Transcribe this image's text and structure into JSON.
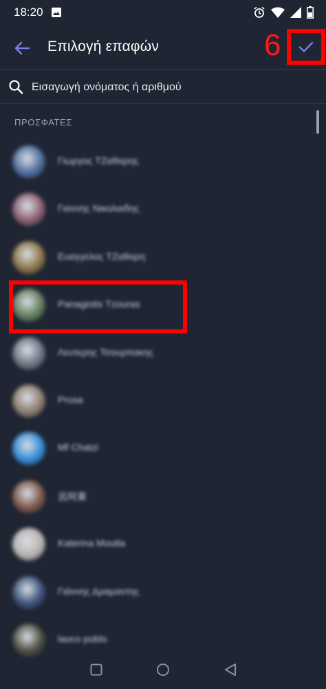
{
  "status_bar": {
    "time": "18:20"
  },
  "app_bar": {
    "title": "Επιλογή επαφών",
    "step_badge": "6"
  },
  "search": {
    "placeholder": "Εισαγωγή ονόματος ή αριθμού"
  },
  "section": {
    "header": "ΠΡΟΣΦΑΤΕΣ"
  },
  "contacts": [
    {
      "name": "Γιωργος ΤΖαθαρης",
      "avatar_color": "#4a6a9a"
    },
    {
      "name": "Γιαννης Νικολαιδης",
      "avatar_color": "#8a5c6e"
    },
    {
      "name": "Ευαγγελος ΤΖαθαρη",
      "avatar_color": "#8a7244"
    },
    {
      "name": "Panagiotis Tzouras",
      "avatar_color": "#5f7a5a"
    },
    {
      "name": "Λευτερης Τσουρπακης",
      "avatar_color": "#6b7280"
    },
    {
      "name": "Prosa",
      "avatar_color": "#8a7a6a"
    },
    {
      "name": "Mf Chatzi",
      "avatar_color": "#2f8ad6"
    },
    {
      "name": "呂阿東",
      "avatar_color": "#7a5446"
    },
    {
      "name": "Katerina Moutla",
      "avatar_color": "#b8b2b0"
    },
    {
      "name": "Γιάννης Δραμαντης",
      "avatar_color": "#3a4f7a"
    },
    {
      "name": "laoco poblo",
      "avatar_color": "#4a4a3e"
    }
  ],
  "colors": {
    "background": "#1f2532",
    "accent": "#7a7de8",
    "annotation_red": "#ff0000"
  }
}
